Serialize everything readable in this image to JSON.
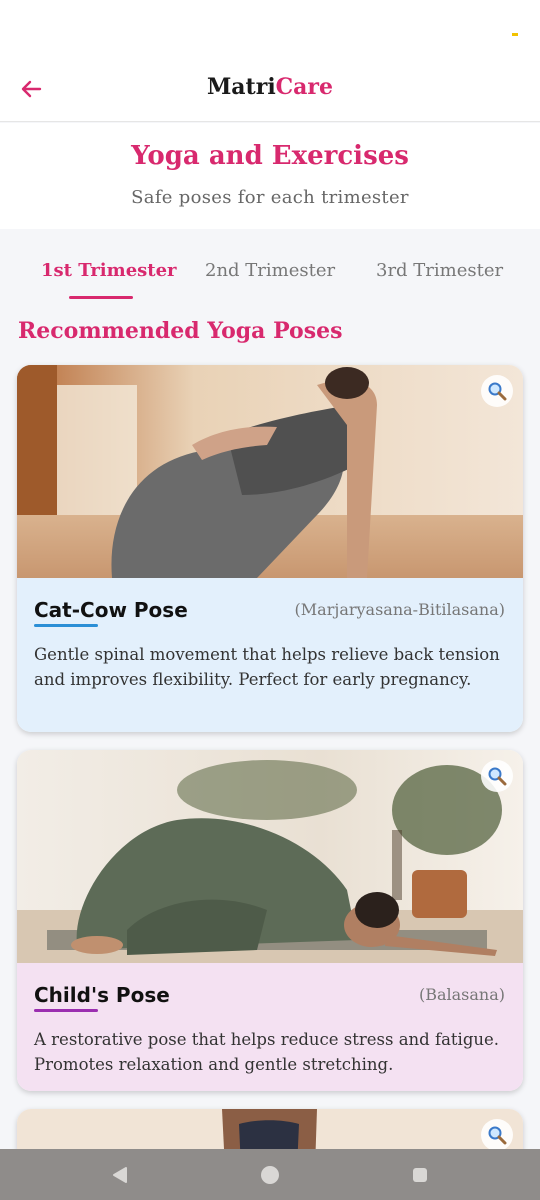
{
  "app": {
    "brand_part1": "Matri",
    "brand_part2": "Care",
    "accent_color": "#d8296e"
  },
  "header": {
    "back_icon": "arrow-left-icon",
    "title": "Yoga and Exercises",
    "subtitle": "Safe poses for each trimester"
  },
  "tabs": [
    {
      "label": "1st Trimester",
      "active": true
    },
    {
      "label": "2nd Trimester",
      "active": false
    },
    {
      "label": "3rd Trimester",
      "active": false
    }
  ],
  "section": {
    "title": "Recommended Yoga Poses"
  },
  "poses": [
    {
      "name": "Cat-Cow Pose",
      "sanskrit": "(Marjaryasana-Bitilasana)",
      "description": "Gentle spinal movement that helps relieve back tension and improves flexibility. Perfect for early pregnancy.",
      "card_color": "#e3f0fc",
      "accent": "#2b8fd6",
      "icon": "zoom-icon"
    },
    {
      "name": "Child's Pose",
      "sanskrit": "(Balasana)",
      "description": "A restorative pose that helps reduce stress and fatigue. Promotes relaxation and gentle stretching.",
      "card_color": "#f4e1f2",
      "accent": "#9b2fb0",
      "icon": "zoom-icon"
    }
  ],
  "nav": {
    "back": "triangle-back-icon",
    "home": "circle-home-icon",
    "recents": "square-recents-icon"
  }
}
